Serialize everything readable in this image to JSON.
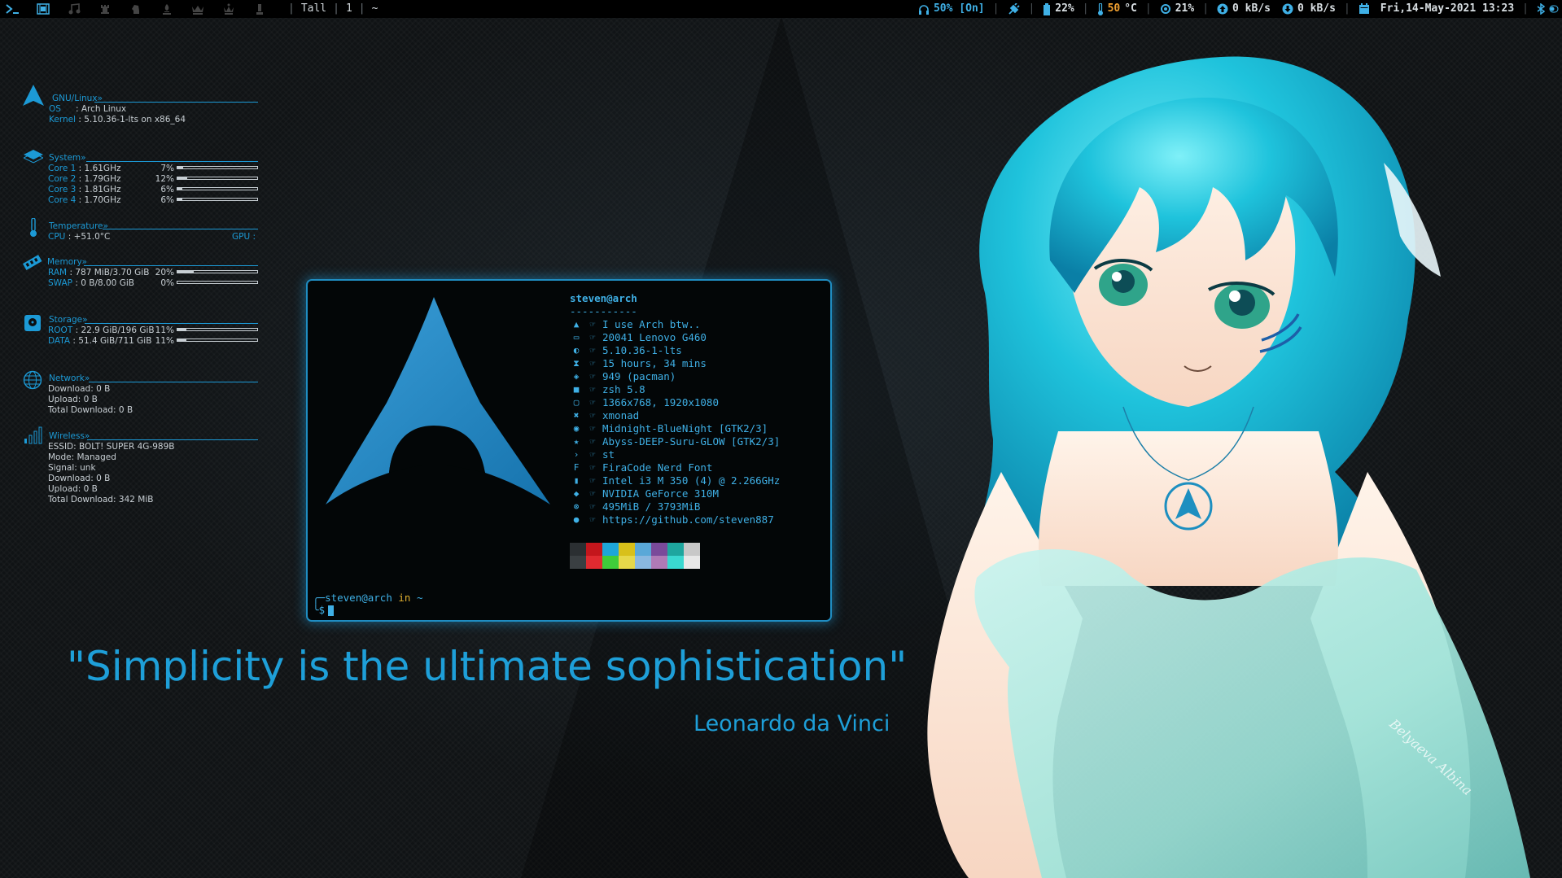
{
  "topbar": {
    "workspace_icons": [
      "terminal-icon",
      "film-icon",
      "music-icon",
      "chess-rook-icon",
      "chess-knight-icon",
      "chess-bishop-icon",
      "chess-king-icon",
      "chess-queen-icon",
      "chess-pawn-icon"
    ],
    "layout": "Tall",
    "window_count": "1",
    "title": "~",
    "volume": "50% [On]",
    "battery": "22%",
    "temp_value": "50",
    "temp_unit": "°C",
    "cpu": "21%",
    "upload": "0 kB/s",
    "download": "0 kB/s",
    "datetime": "Fri,14-May-2021 13:23",
    "accent": "#3fb0e6"
  },
  "conky": {
    "os": {
      "header": "GNU/Linux»",
      "os_label": "OS",
      "os_value": ": Arch Linux",
      "kernel_label": "Kernel",
      "kernel_value": ": 5.10.36-1-lts on x86_64"
    },
    "system": {
      "header": "System»",
      "cores": [
        {
          "label": "Core 1",
          "freq": ": 1.61GHz",
          "pct": "7%",
          "value": 0.07
        },
        {
          "label": "Core 2",
          "freq": ": 1.79GHz",
          "pct": "12%",
          "value": 0.12
        },
        {
          "label": "Core 3",
          "freq": ": 1.81GHz",
          "pct": "6%",
          "value": 0.06
        },
        {
          "label": "Core 4",
          "freq": ": 1.70GHz",
          "pct": "6%",
          "value": 0.06
        }
      ]
    },
    "temperature": {
      "header": "Temperature»",
      "cpu_label": "CPU",
      "cpu_value": ": +51.0°C",
      "gpu_label": "GPU :"
    },
    "memory": {
      "header": "Memory»",
      "ram_label": "RAM",
      "ram_value": ": 787 MiB/3.70 GiB",
      "ram_pct": "20%",
      "ram_fill": 0.2,
      "swap_label": "SWAP",
      "swap_value": ": 0 B/8.00 GiB",
      "swap_pct": "0%",
      "swap_fill": 0
    },
    "storage": {
      "header": "Storage»",
      "root_label": "ROOT",
      "root_value": ": 22.9 GiB/196 GiB",
      "root_pct": "11%",
      "root_fill": 0.11,
      "data_label": "DATA",
      "data_value": ": 51.4 GiB/711 GiB",
      "data_pct": "11%",
      "data_fill": 0.11
    },
    "network": {
      "header": "Network»",
      "download": "Download: 0 B",
      "upload": "Upload: 0 B",
      "total": "Total Download:  0 B"
    },
    "wireless": {
      "header": "Wireless»",
      "essid": "ESSID: BOLT! SUPER 4G-989B",
      "mode": "Mode: Managed",
      "signal": "Signal: unk",
      "download": "Download: 0 B",
      "upload": "Upload: 0 B",
      "total": "Total Download: 342 MiB"
    }
  },
  "terminal": {
    "user_host": "steven@arch",
    "dashes": "-----------",
    "lines": [
      {
        "icon": "arch-icon",
        "glyph": "▲",
        "value": "I use Arch btw.."
      },
      {
        "icon": "laptop-icon",
        "glyph": "▭",
        "value": "20041 Lenovo G460"
      },
      {
        "icon": "tux-icon",
        "glyph": "◐",
        "value": "5.10.36-1-lts"
      },
      {
        "icon": "hourglass-icon",
        "glyph": "⧗",
        "value": "15 hours, 34 mins"
      },
      {
        "icon": "package-icon",
        "glyph": "◈",
        "value": "949 (pacman)"
      },
      {
        "icon": "shell-icon",
        "glyph": "■",
        "value": "zsh 5.8"
      },
      {
        "icon": "monitor-icon",
        "glyph": "▢",
        "value": "1366x768, 1920x1080"
      },
      {
        "icon": "wm-icon",
        "glyph": "✖",
        "value": "xmonad"
      },
      {
        "icon": "palette-icon",
        "glyph": "◉",
        "value": "Midnight-BlueNight [GTK2/3]"
      },
      {
        "icon": "star-icon",
        "glyph": "★",
        "value": "Abyss-DEEP-Suru-GLOW [GTK2/3]"
      },
      {
        "icon": "prompt-icon",
        "glyph": "›",
        "value": "st"
      },
      {
        "icon": "font-icon",
        "glyph": "F",
        "value": "FiraCode Nerd Font"
      },
      {
        "icon": "cpu-icon",
        "glyph": "▮",
        "value": "Intel i3 M 350 (4) @ 2.266GHz"
      },
      {
        "icon": "gpu-icon",
        "glyph": "◆",
        "value": "NVIDIA GeForce 310M"
      },
      {
        "icon": "memory-icon",
        "glyph": "⊛",
        "value": "495MiB / 3793MiB"
      },
      {
        "icon": "github-icon",
        "glyph": "●",
        "value": "https://github.com/steven887"
      }
    ],
    "palette_top": [
      "#2b2f32",
      "#c4161c",
      "#1ea6d8",
      "#d8c01a",
      "#5aa8d8",
      "#7a4a9a",
      "#1ea69e",
      "#c8c8c8"
    ],
    "palette_bottom": [
      "#3a3f42",
      "#e02a30",
      "#3fcc3a",
      "#e6d84a",
      "#8ab8e0",
      "#b07ab6",
      "#3ad8d0",
      "#e8e8e8"
    ],
    "prompt_user": "steven@arch",
    "prompt_in": "in",
    "prompt_dir": "~",
    "prompt_symbol": "$"
  },
  "quote": {
    "text": "\"Simplicity is the ultimate sophistication\"",
    "author": "Leonardo da Vinci"
  },
  "art": {
    "signature": "Belyaeva Albina"
  }
}
